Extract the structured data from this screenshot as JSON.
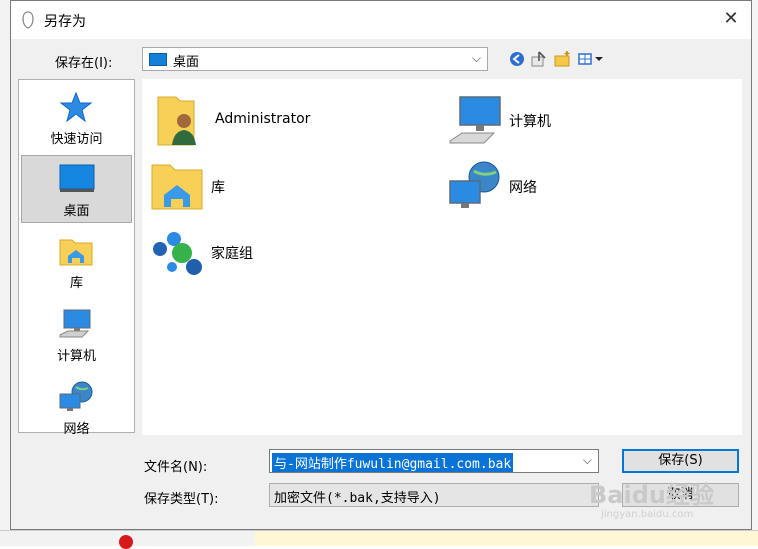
{
  "dialog": {
    "title": "另存为",
    "close_symbol": "✕"
  },
  "save_in": {
    "label": "保存在(I):",
    "value": "桌面",
    "icon": "desktop-folder-icon"
  },
  "toolbar": {
    "back_icon": "back-arrow-icon",
    "up_icon": "up-folder-icon",
    "new_folder_icon": "new-folder-icon",
    "view_menu_icon": "view-menu-icon"
  },
  "places": [
    {
      "label": "快速访问",
      "icon": "star-icon",
      "selected": false
    },
    {
      "label": "桌面",
      "icon": "desktop-icon",
      "selected": true
    },
    {
      "label": "库",
      "icon": "library-folder-icon",
      "selected": false
    },
    {
      "label": "计算机",
      "icon": "computer-icon",
      "selected": false
    },
    {
      "label": "网络",
      "icon": "network-icon",
      "selected": false
    }
  ],
  "files": [
    {
      "name": "Administrator",
      "icon": "user-folder-icon"
    },
    {
      "name": "计算机",
      "icon": "computer-icon"
    },
    {
      "name": "库",
      "icon": "library-folder-icon"
    },
    {
      "name": "网络",
      "icon": "network-icon"
    },
    {
      "name": "家庭组",
      "icon": "homegroup-icon"
    }
  ],
  "filename": {
    "label": "文件名(N):",
    "value": "与-网站制作fuwulin@gmail.com.bak"
  },
  "filetype": {
    "label": "保存类型(T):",
    "value": "加密文件(*.bak,支持导入)"
  },
  "buttons": {
    "save": "保存(S)",
    "cancel": "取消"
  },
  "watermark": {
    "brand": "Baidu经验",
    "url": "jingyan.baidu.com"
  },
  "colors": {
    "accent": "#0078d7",
    "selection": "#0a74d6",
    "dialog_bg": "#f0f0f0"
  }
}
